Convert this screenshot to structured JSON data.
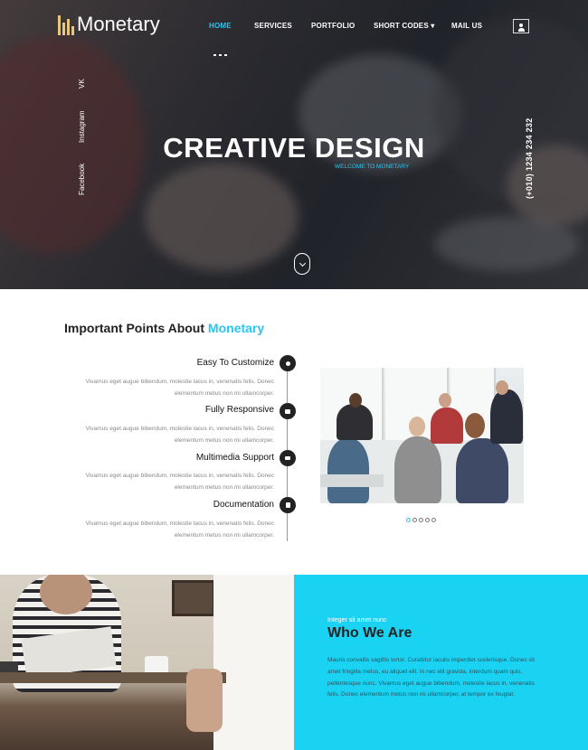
{
  "header": {
    "logo_text": "Monetary",
    "nav": [
      {
        "label": "HOME",
        "active": true
      },
      {
        "label": "SERVICES",
        "active": false
      },
      {
        "label": "PORTFOLIO",
        "active": false
      },
      {
        "label": "SHORT CODES ▾",
        "active": false
      },
      {
        "label": "MAIL US",
        "active": false
      }
    ],
    "user_icon": "user-icon"
  },
  "hero": {
    "social": [
      "VK",
      "Instagram",
      "Facebook"
    ],
    "phone": "(+010) 1234 234 232",
    "title": "CREATIVE DESIGN",
    "subtitle": "WELCOME TO MONETARY",
    "scroll_icon": "chevron-down-icon"
  },
  "points": {
    "heading": "Important Points About",
    "heading_accent": "Monetary",
    "items": [
      {
        "title": "Easy To Customize",
        "icon": "share-icon",
        "desc_line1": "Vivamus eget augue bibendum, molestie lacus in, venenatis felis. Donec",
        "desc_line2": "elementum metus non mi ullamcorper."
      },
      {
        "title": "Fully Responsive",
        "icon": "monitor-icon",
        "desc_line1": "Vivamus eget augue bibendum, molestie lacus in, venenatis felis. Donec",
        "desc_line2": "elementum metus non mi ullamcorper."
      },
      {
        "title": "Multimedia Support",
        "icon": "video-icon",
        "desc_line1": "Vivamus eget augue bibendum, molestie lacus in, venenatis felis. Donec",
        "desc_line2": "elementum metus non mi ullamcorper."
      },
      {
        "title": "Documentation",
        "icon": "document-icon",
        "desc_line1": "Vivamus eget augue bibendum, molestie lacus in, venenatis felis. Donec",
        "desc_line2": "elementum metus non mi ullamcorper."
      }
    ],
    "carousel": {
      "slides": 5,
      "active": 0
    }
  },
  "who": {
    "kicker": "Integer sit amet nunc",
    "title": "Who We Are",
    "text": "Mauris convallis sagittis tortor. Curabitur iaculis imperdiet scelerisque. Donec sit amet fringilla metus, eu aliquet elit. In nec elit gravida, interdum quam quis, pellentesque nunc. Vivamus eget augue bibendum, molestie lacus in, venenatis felis. Donec elementum metus non mi ullamcorper, at tempor ex feugiat."
  },
  "colors": {
    "accent": "#27c6f0",
    "who_bg": "#1ad3f3",
    "dark": "#222222"
  }
}
